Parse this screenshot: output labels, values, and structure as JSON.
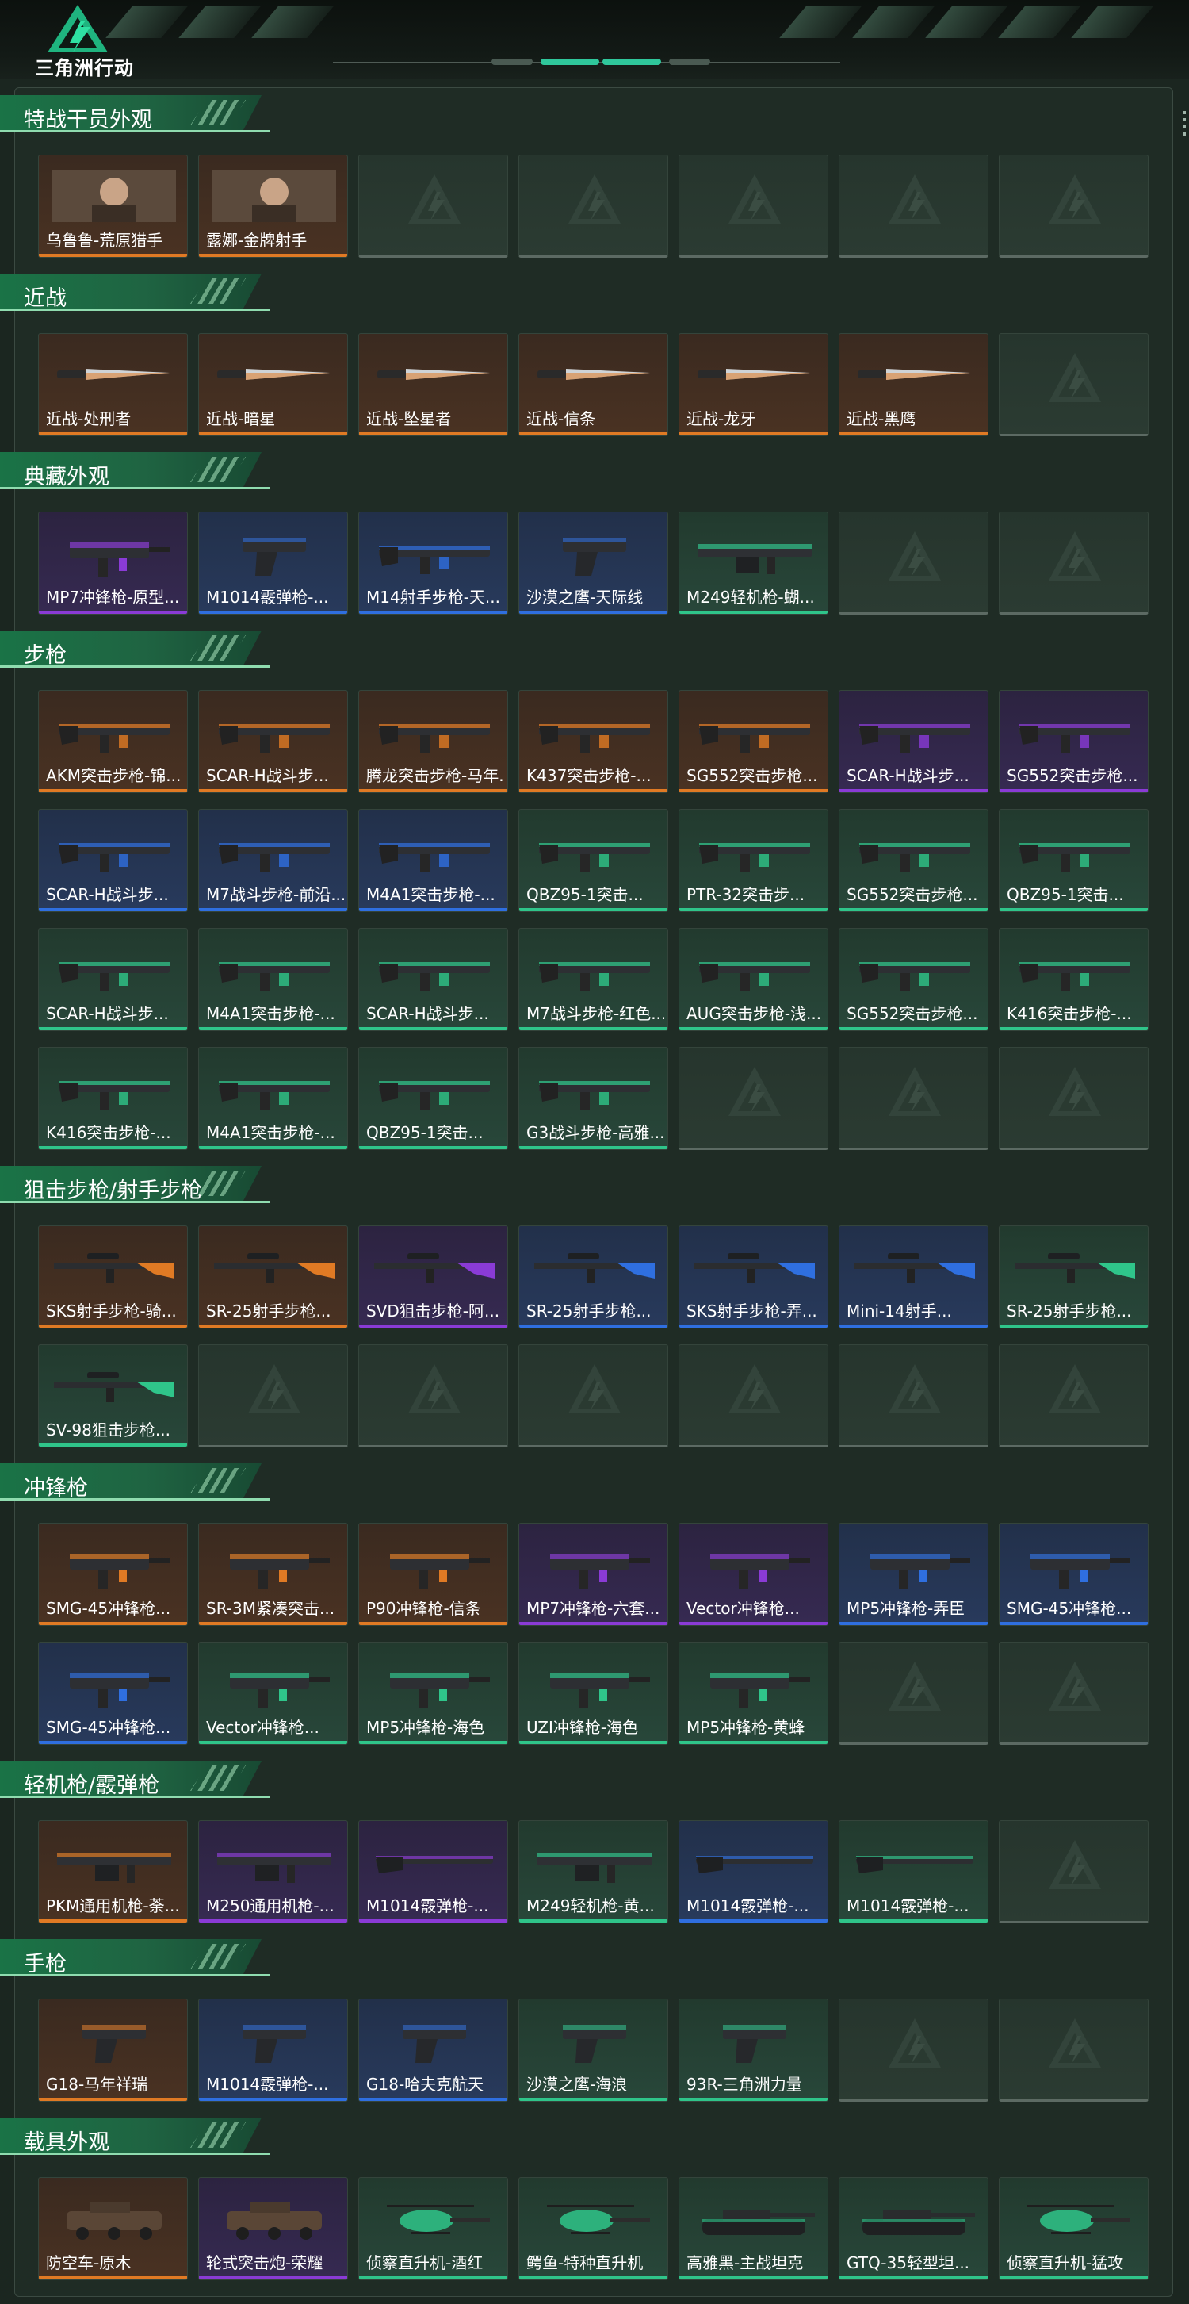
{
  "app": {
    "brand": "三角洲行动"
  },
  "colors": {
    "gold": "#e07a24",
    "purple": "#8a3bd6",
    "blue": "#2f6fe0",
    "green": "#2fc58a",
    "empty": "#5c6a63"
  },
  "sections": [
    {
      "title": "特战干员外观",
      "items": [
        {
          "label": "乌鲁鲁-荒原猎手",
          "rarity": "gold",
          "icon": "operator-portrait-icon"
        },
        {
          "label": "露娜-金牌射手",
          "rarity": "gold",
          "icon": "operator-portrait-icon"
        },
        {
          "label": "",
          "rarity": "empty"
        },
        {
          "label": "",
          "rarity": "empty"
        },
        {
          "label": "",
          "rarity": "empty"
        },
        {
          "label": "",
          "rarity": "empty"
        },
        {
          "label": "",
          "rarity": "empty"
        }
      ]
    },
    {
      "title": "近战",
      "items": [
        {
          "label": "近战-处刑者",
          "rarity": "gold",
          "icon": "melee-blade-icon"
        },
        {
          "label": "近战-暗星",
          "rarity": "gold",
          "icon": "melee-blade-icon"
        },
        {
          "label": "近战-坠星者",
          "rarity": "gold",
          "icon": "melee-blade-icon"
        },
        {
          "label": "近战-信条",
          "rarity": "gold",
          "icon": "melee-blade-icon"
        },
        {
          "label": "近战-龙牙",
          "rarity": "gold",
          "icon": "melee-blade-icon"
        },
        {
          "label": "近战-黑鹰",
          "rarity": "gold",
          "icon": "melee-blade-icon"
        },
        {
          "label": "",
          "rarity": "empty"
        }
      ]
    },
    {
      "title": "典藏外观",
      "items": [
        {
          "label": "MP7冲锋枪-原型...",
          "rarity": "purple",
          "icon": "smg-icon"
        },
        {
          "label": "M1014霰弹枪-...",
          "rarity": "blue",
          "icon": "pistol-icon"
        },
        {
          "label": "M14射手步枪-天...",
          "rarity": "blue",
          "icon": "rifle-icon"
        },
        {
          "label": "沙漠之鹰-天际线",
          "rarity": "blue",
          "icon": "pistol-icon"
        },
        {
          "label": "M249轻机枪-蝴...",
          "rarity": "green",
          "icon": "lmg-icon"
        },
        {
          "label": "",
          "rarity": "empty"
        },
        {
          "label": "",
          "rarity": "empty"
        }
      ]
    },
    {
      "title": "步枪",
      "items": [
        {
          "label": "AKM突击步枪-锦...",
          "rarity": "gold",
          "icon": "rifle-icon"
        },
        {
          "label": "SCAR-H战斗步...",
          "rarity": "gold",
          "icon": "rifle-icon"
        },
        {
          "label": "腾龙突击步枪-马年...",
          "rarity": "gold",
          "icon": "rifle-icon"
        },
        {
          "label": "K437突击步枪-...",
          "rarity": "gold",
          "icon": "rifle-icon"
        },
        {
          "label": "SG552突击步枪...",
          "rarity": "gold",
          "icon": "rifle-icon"
        },
        {
          "label": "SCAR-H战斗步...",
          "rarity": "purple",
          "icon": "rifle-icon"
        },
        {
          "label": "SG552突击步枪...",
          "rarity": "purple",
          "icon": "rifle-icon"
        },
        {
          "label": "SCAR-H战斗步...",
          "rarity": "blue",
          "icon": "rifle-icon"
        },
        {
          "label": "M7战斗步枪-前沿...",
          "rarity": "blue",
          "icon": "rifle-icon"
        },
        {
          "label": "M4A1突击步枪-...",
          "rarity": "blue",
          "icon": "rifle-icon"
        },
        {
          "label": "QBZ95-1突击...",
          "rarity": "green",
          "icon": "rifle-icon"
        },
        {
          "label": "PTR-32突击步...",
          "rarity": "green",
          "icon": "rifle-icon"
        },
        {
          "label": "SG552突击步枪...",
          "rarity": "green",
          "icon": "rifle-icon"
        },
        {
          "label": "QBZ95-1突击...",
          "rarity": "green",
          "icon": "rifle-icon"
        },
        {
          "label": "SCAR-H战斗步...",
          "rarity": "green",
          "icon": "rifle-icon"
        },
        {
          "label": "M4A1突击步枪-...",
          "rarity": "green",
          "icon": "rifle-icon"
        },
        {
          "label": "SCAR-H战斗步...",
          "rarity": "green",
          "icon": "rifle-icon"
        },
        {
          "label": "M7战斗步枪-红色...",
          "rarity": "green",
          "icon": "rifle-icon"
        },
        {
          "label": "AUG突击步枪-浅...",
          "rarity": "green",
          "icon": "rifle-icon"
        },
        {
          "label": "SG552突击步枪...",
          "rarity": "green",
          "icon": "rifle-icon"
        },
        {
          "label": "K416突击步枪-...",
          "rarity": "green",
          "icon": "rifle-icon"
        },
        {
          "label": "K416突击步枪-...",
          "rarity": "green",
          "icon": "rifle-icon"
        },
        {
          "label": "M4A1突击步枪-...",
          "rarity": "green",
          "icon": "rifle-icon"
        },
        {
          "label": "QBZ95-1突击...",
          "rarity": "green",
          "icon": "rifle-icon"
        },
        {
          "label": "G3战斗步枪-高雅...",
          "rarity": "green",
          "icon": "rifle-icon"
        },
        {
          "label": "",
          "rarity": "empty"
        },
        {
          "label": "",
          "rarity": "empty"
        },
        {
          "label": "",
          "rarity": "empty"
        }
      ]
    },
    {
      "title": "狙击步枪/射手步枪",
      "items": [
        {
          "label": "SKS射手步枪-骑...",
          "rarity": "gold",
          "icon": "sniper-icon"
        },
        {
          "label": "SR-25射手步枪...",
          "rarity": "gold",
          "icon": "sniper-icon"
        },
        {
          "label": "SVD狙击步枪-阿...",
          "rarity": "purple",
          "icon": "sniper-icon"
        },
        {
          "label": "SR-25射手步枪...",
          "rarity": "blue",
          "icon": "sniper-icon"
        },
        {
          "label": "SKS射手步枪-弄...",
          "rarity": "blue",
          "icon": "sniper-icon"
        },
        {
          "label": "Mini-14射手...",
          "rarity": "blue",
          "icon": "sniper-icon"
        },
        {
          "label": "SR-25射手步枪...",
          "rarity": "green",
          "icon": "sniper-icon"
        },
        {
          "label": "SV-98狙击步枪...",
          "rarity": "green",
          "icon": "sniper-icon"
        },
        {
          "label": "",
          "rarity": "empty"
        },
        {
          "label": "",
          "rarity": "empty"
        },
        {
          "label": "",
          "rarity": "empty"
        },
        {
          "label": "",
          "rarity": "empty"
        },
        {
          "label": "",
          "rarity": "empty"
        },
        {
          "label": "",
          "rarity": "empty"
        }
      ]
    },
    {
      "title": "冲锋枪",
      "items": [
        {
          "label": "SMG-45冲锋枪...",
          "rarity": "gold",
          "icon": "smg-icon"
        },
        {
          "label": "SR-3M紧凑突击...",
          "rarity": "gold",
          "icon": "smg-icon"
        },
        {
          "label": "P90冲锋枪-信条",
          "rarity": "gold",
          "icon": "smg-icon"
        },
        {
          "label": "MP7冲锋枪-六套...",
          "rarity": "purple",
          "icon": "smg-icon"
        },
        {
          "label": "Vector冲锋枪...",
          "rarity": "purple",
          "icon": "smg-icon"
        },
        {
          "label": "MP5冲锋枪-弄臣",
          "rarity": "blue",
          "icon": "smg-icon"
        },
        {
          "label": "SMG-45冲锋枪...",
          "rarity": "blue",
          "icon": "smg-icon"
        },
        {
          "label": "SMG-45冲锋枪...",
          "rarity": "blue",
          "icon": "smg-icon"
        },
        {
          "label": "Vector冲锋枪...",
          "rarity": "green",
          "icon": "smg-icon"
        },
        {
          "label": "MP5冲锋枪-海色",
          "rarity": "green",
          "icon": "smg-icon"
        },
        {
          "label": "UZI冲锋枪-海色",
          "rarity": "green",
          "icon": "smg-icon"
        },
        {
          "label": "MP5冲锋枪-黄蜂",
          "rarity": "green",
          "icon": "smg-icon"
        },
        {
          "label": "",
          "rarity": "empty"
        },
        {
          "label": "",
          "rarity": "empty"
        }
      ]
    },
    {
      "title": "轻机枪/霰弹枪",
      "items": [
        {
          "label": "PKM通用机枪-荼...",
          "rarity": "gold",
          "icon": "lmg-icon"
        },
        {
          "label": "M250通用机枪-...",
          "rarity": "purple",
          "icon": "lmg-icon"
        },
        {
          "label": "M1014霰弹枪-...",
          "rarity": "purple",
          "icon": "shotgun-icon"
        },
        {
          "label": "M249轻机枪-黄...",
          "rarity": "green",
          "icon": "lmg-icon"
        },
        {
          "label": "M1014霰弹枪-...",
          "rarity": "blue",
          "icon": "shotgun-icon"
        },
        {
          "label": "M1014霰弹枪-...",
          "rarity": "green",
          "icon": "shotgun-icon"
        },
        {
          "label": "",
          "rarity": "empty"
        }
      ]
    },
    {
      "title": "手枪",
      "items": [
        {
          "label": "G18-马年祥瑞",
          "rarity": "gold",
          "icon": "pistol-icon"
        },
        {
          "label": "M1014霰弹枪-...",
          "rarity": "blue",
          "icon": "pistol-icon"
        },
        {
          "label": "G18-哈夫克航天",
          "rarity": "blue",
          "icon": "pistol-icon"
        },
        {
          "label": "沙漠之鹰-海浪",
          "rarity": "green",
          "icon": "pistol-icon"
        },
        {
          "label": "93R-三角洲力量",
          "rarity": "green",
          "icon": "pistol-icon"
        },
        {
          "label": "",
          "rarity": "empty"
        },
        {
          "label": "",
          "rarity": "empty"
        }
      ]
    },
    {
      "title": "载具外观",
      "items": [
        {
          "label": "防空车-原木",
          "rarity": "gold",
          "icon": "vehicle-icon"
        },
        {
          "label": "轮式突击炮-荣耀",
          "rarity": "purple",
          "icon": "vehicle-icon"
        },
        {
          "label": "侦察直升机-酒红",
          "rarity": "green",
          "icon": "helicopter-icon"
        },
        {
          "label": "鳄鱼-特种直升机",
          "rarity": "green",
          "icon": "helicopter-icon"
        },
        {
          "label": "高雅黑-主战坦克",
          "rarity": "green",
          "icon": "tank-icon"
        },
        {
          "label": "GTQ-35轻型坦...",
          "rarity": "green",
          "icon": "tank-icon"
        },
        {
          "label": "侦察直升机-猛攻",
          "rarity": "green",
          "icon": "helicopter-icon"
        }
      ]
    }
  ]
}
